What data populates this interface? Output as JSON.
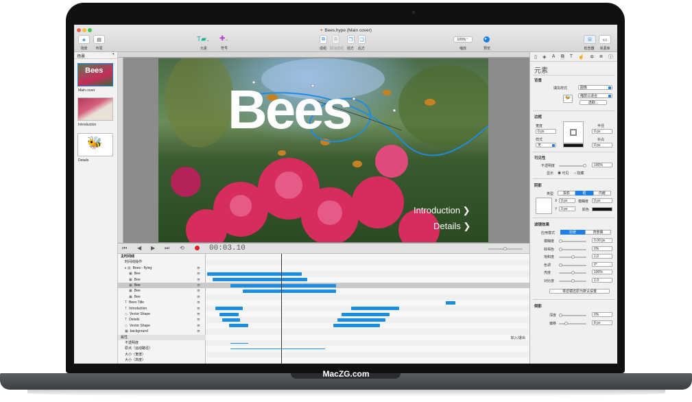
{
  "brand": "MacZG.com",
  "window": {
    "title": "Bees.hype (Main cover)"
  },
  "toolbar": {
    "scenes_label": "场景",
    "layout_label": "布局",
    "elements_label": "元素",
    "symbols_label": "符号",
    "group_label": "成组",
    "ungroup_label": "取消成组",
    "front_label": "前方",
    "back_label": "后方",
    "zoom_value": "100%",
    "zoom_label": "缩放",
    "preview_label": "预览",
    "inspector_label": "检查器",
    "library_label": "资源库"
  },
  "scenes": {
    "header": "场景",
    "add": "+",
    "items": [
      {
        "label": "Main cover",
        "thumb_text": "Bees"
      },
      {
        "label": "Introduction",
        "thumb_text": ""
      },
      {
        "label": "Details",
        "thumb_text": ""
      }
    ]
  },
  "stage": {
    "title": "Bees",
    "link_intro": "Introduction",
    "link_details": "Details",
    "chevron": "❯"
  },
  "timeline": {
    "time": "00:03.10",
    "main_timeline": "主时间线",
    "timeline_action": "时间线操作",
    "rows": [
      {
        "label": "Bees - flying",
        "icon": "▸ ▤",
        "indent": 0
      },
      {
        "label": "Bee",
        "icon": "▣",
        "indent": 1
      },
      {
        "label": "Bee",
        "icon": "▣",
        "indent": 1
      },
      {
        "label": "Bee",
        "icon": "▣",
        "indent": 1,
        "selected": true
      },
      {
        "label": "Bee",
        "icon": "▣",
        "indent": 1
      },
      {
        "label": "Bee",
        "icon": "▣",
        "indent": 1
      },
      {
        "label": "Bees Title",
        "icon": "T",
        "indent": 0
      },
      {
        "label": "Introduction",
        "icon": "T",
        "indent": 0
      },
      {
        "label": "Vector Shape",
        "icon": "◇",
        "indent": 0
      },
      {
        "label": "Details",
        "icon": "T",
        "indent": 0
      },
      {
        "label": "Vector Shape",
        "icon": "◇",
        "indent": 0
      },
      {
        "label": "background",
        "icon": "▣",
        "indent": 0
      }
    ],
    "properties": "属性",
    "prop_rows": [
      "不透明度",
      "原点（运动路径）",
      "大小（宽度）",
      "大小（高度）"
    ],
    "ease": "加入/退出"
  },
  "inspector": {
    "title": "元素",
    "background": "背景",
    "fill_style": "填充样式",
    "fill_value": "图像",
    "scale": "缩放以适合",
    "choose": "选取...",
    "border": "边框",
    "width": "宽度",
    "radius": "半径",
    "width_value": "0 px",
    "style": "样式",
    "style_value": "无",
    "padding": "补白",
    "visibility": "可见性",
    "opacity": "不透明度",
    "opacity_value": "100%",
    "display": "显示",
    "visible": "可见",
    "hidden": "隐藏",
    "shadow": "阴影",
    "type": "类型",
    "shadow_types": [
      "投影",
      "框",
      "内嵌"
    ],
    "x": "X",
    "y": "Y",
    "xval": "0 px",
    "yval": "0 px",
    "blur": "模糊度",
    "blurval": "0 px",
    "color": "颜色",
    "filters": "滤镜效果",
    "apply_mode": "应用模式",
    "apply_modes": [
      "前景",
      "背景幕"
    ],
    "filter_rows": [
      {
        "label": "模糊度",
        "value": "0.00 px"
      },
      {
        "label": "棕褐色",
        "value": "0%"
      },
      {
        "label": "饱和度",
        "value": "1.0"
      },
      {
        "label": "色调",
        "value": "0°"
      },
      {
        "label": "亮度",
        "value": "100%"
      },
      {
        "label": "对比度",
        "value": "1.0"
      }
    ],
    "reset": "将滤镜还原为默认设置",
    "reflection": "倒影",
    "depth": "深度",
    "depth_value": "0%",
    "offset": "偏移",
    "offset_value": "8 px"
  },
  "colors": {
    "accent": "#1d8de0",
    "title_bar": "#dadada"
  }
}
